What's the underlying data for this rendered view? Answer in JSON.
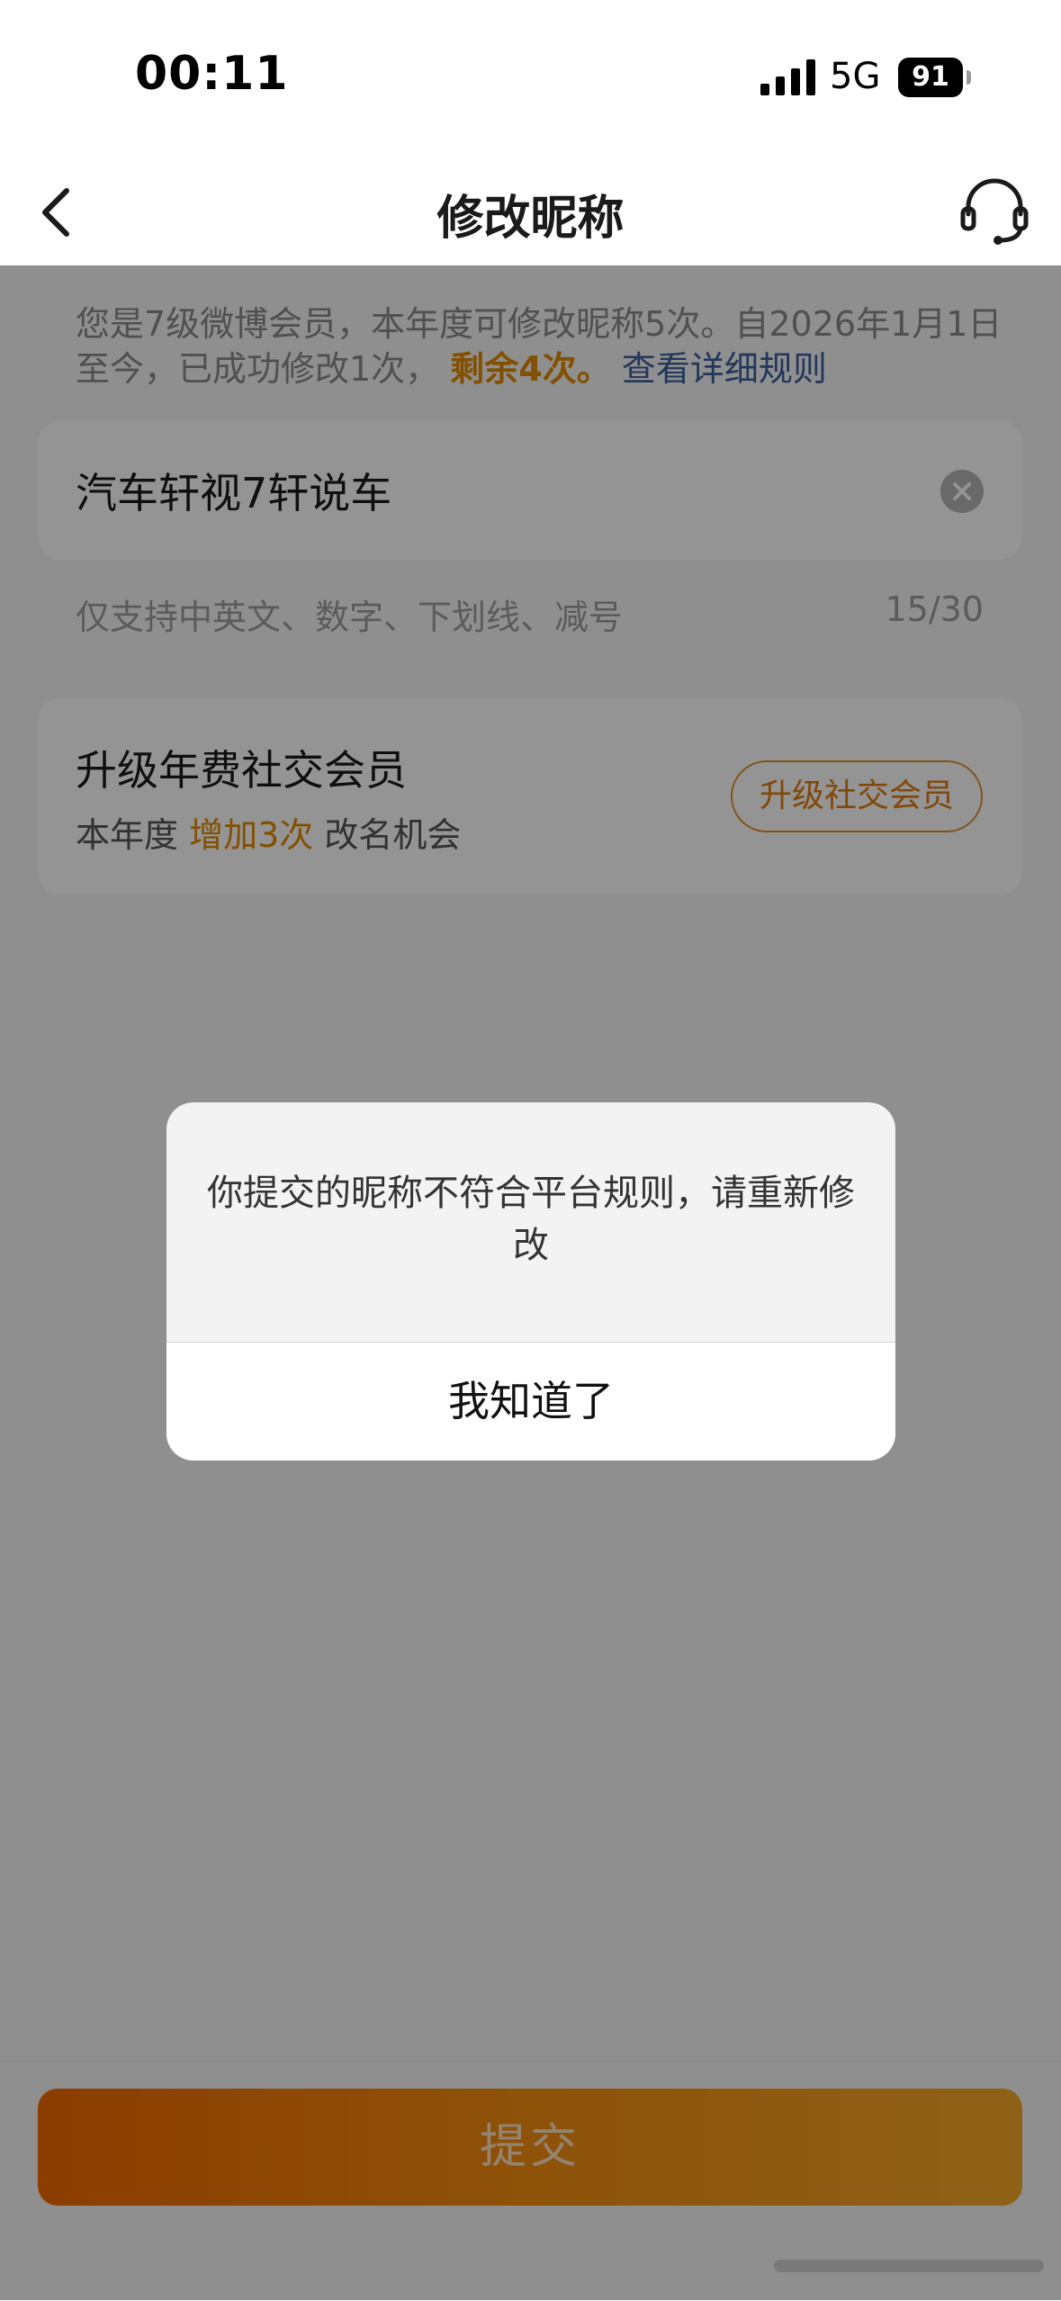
{
  "status_bar": {
    "time": "00:11",
    "network": "5G",
    "battery": "91",
    "signal_icon": "signal-bars-icon",
    "battery_icon": "battery-icon"
  },
  "header": {
    "title": "修改昵称",
    "back_icon": "chevron-left-icon",
    "support_icon": "headset-icon"
  },
  "notice": {
    "text": "您是7级微博会员，本年度可修改昵称5次。自2026年1月1日至今，已成功修改1次，",
    "remaining": "剩余4次。",
    "rules_link": "查看详细规则"
  },
  "nickname_input": {
    "value": "汽车轩视7轩说车",
    "clear_icon": "clear-circle-icon",
    "hint": "仅支持中英文、数字、下划线、减号",
    "counter": "15/30"
  },
  "upgrade_card": {
    "title": "升级年费社交会员",
    "desc_prefix": "本年度",
    "desc_highlight": "增加3次",
    "desc_suffix": "改名机会",
    "button_label": "升级社交会员"
  },
  "submit": {
    "label": "提交"
  },
  "alert": {
    "message": "你提交的昵称不符合平台规则，请重新修改",
    "confirm_label": "我知道了"
  },
  "colors": {
    "accent": "#e08a00",
    "link": "#3d5f9e",
    "submit_gradient_start": "#f26a00",
    "submit_gradient_end": "#f4a829"
  }
}
